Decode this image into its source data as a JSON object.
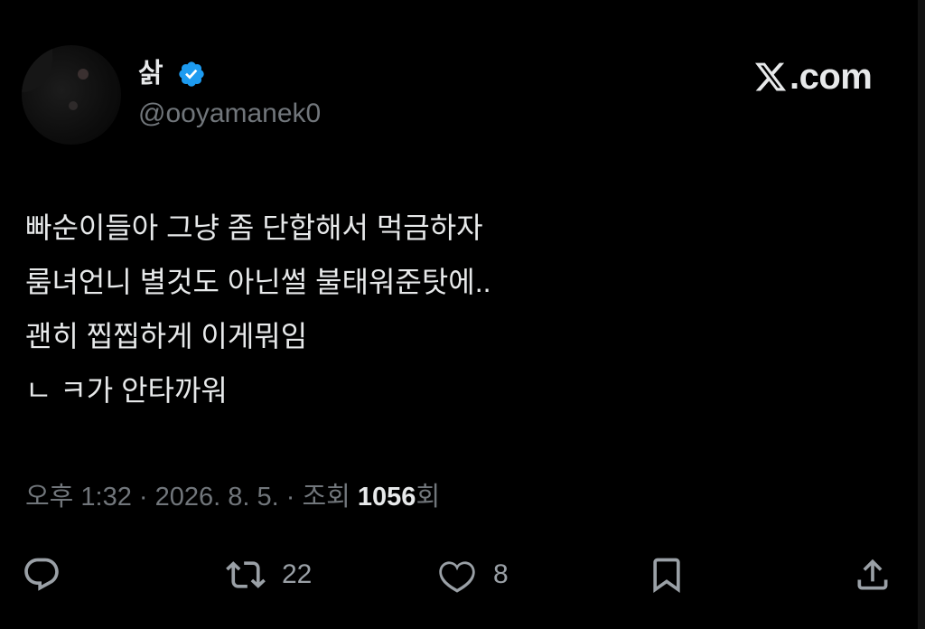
{
  "author": {
    "display_name": "삵",
    "handle": "@ooyamanek0",
    "verified": true
  },
  "brand": {
    "logo_text": ".com",
    "logo_icon": "x-logo-icon"
  },
  "tweet": {
    "lines": [
      "빠순이들아 그냥 좀 단합해서 먹금하자",
      "룸녀언니 별것도 아닌썰 불태워준탓에..",
      "괜히 찝찝하게 이게뭐임",
      "ㄴ ㅋ가 안타까워"
    ]
  },
  "meta": {
    "time": "오후 1:32",
    "separator": " · ",
    "date": "2026. 8. 5.",
    "views_label": "조회 ",
    "views_count": "1056",
    "views_suffix": "회"
  },
  "actions": {
    "reply_icon": "reply-icon",
    "retweet_icon": "retweet-icon",
    "retweet_count": "22",
    "like_icon": "heart-icon",
    "like_count": "8",
    "bookmark_icon": "bookmark-icon",
    "share_icon": "share-icon"
  },
  "colors": {
    "background": "#000000",
    "text_primary": "#e7e9ea",
    "text_secondary": "#71767b",
    "verified_blue": "#1d9bf0"
  }
}
